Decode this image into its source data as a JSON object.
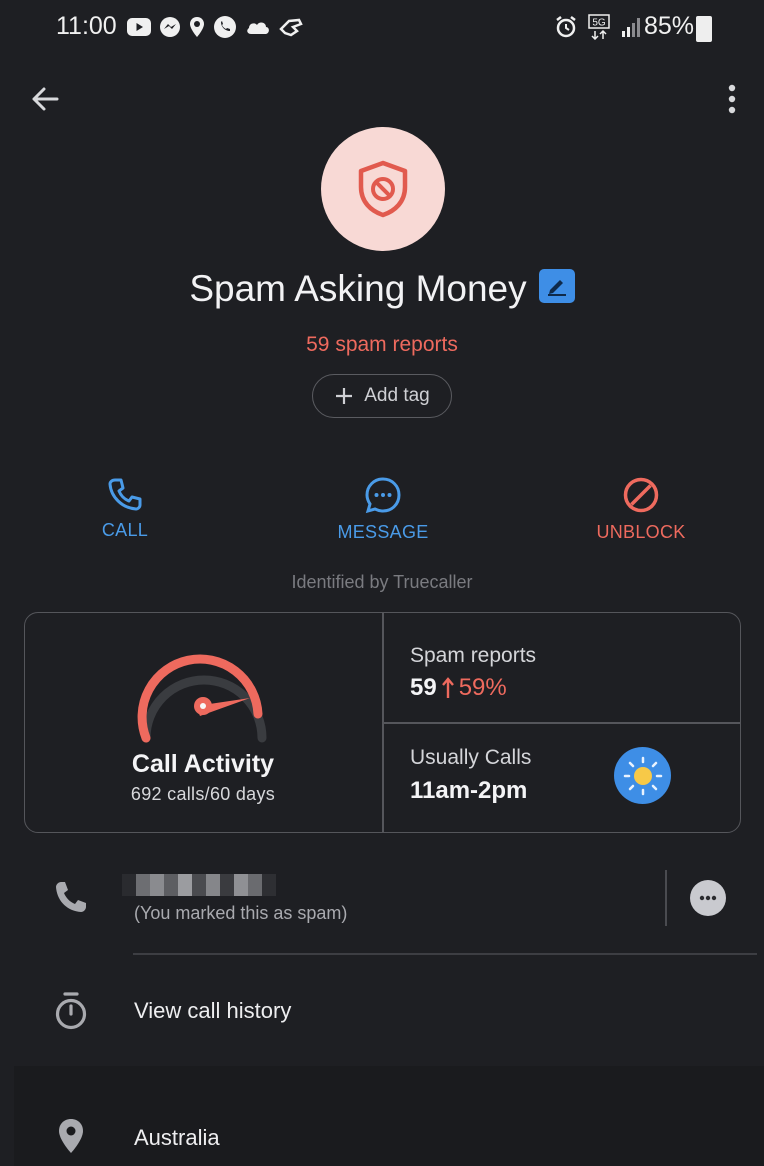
{
  "status_bar": {
    "time": "11:00",
    "battery": "85%",
    "icons_left": [
      "youtube-icon",
      "messenger-icon",
      "location-icon",
      "whatsapp-icon",
      "cloud-icon",
      "hand-icon"
    ],
    "icons_right": [
      "alarm-icon",
      "5g-icon",
      "signal-icon",
      "battery-icon"
    ]
  },
  "contact": {
    "name": "Spam Asking Money",
    "spam_reports_text": "59 spam reports",
    "add_tag": "Add tag"
  },
  "actions": {
    "call": "CALL",
    "message": "MESSAGE",
    "unblock": "UNBLOCK"
  },
  "identified_by": "Identified by Truecaller",
  "stats": {
    "call_activity_title": "Call Activity",
    "call_activity_sub": "692 calls/60 days",
    "spam_reports_label": "Spam reports",
    "spam_reports_value": "59",
    "spam_reports_change": "59%",
    "usually_calls_label": "Usually Calls",
    "usually_calls_value": "11am-2pm"
  },
  "number_row": {
    "note": "(You marked this as spam)"
  },
  "history_row": {
    "label": "View call history"
  },
  "location_row": {
    "label": "Australia"
  },
  "colors": {
    "background": "#1e1f23",
    "accent_blue": "#4a9be8",
    "spam_red": "#ee6a5e",
    "avatar_bg": "#f8d9d5"
  }
}
